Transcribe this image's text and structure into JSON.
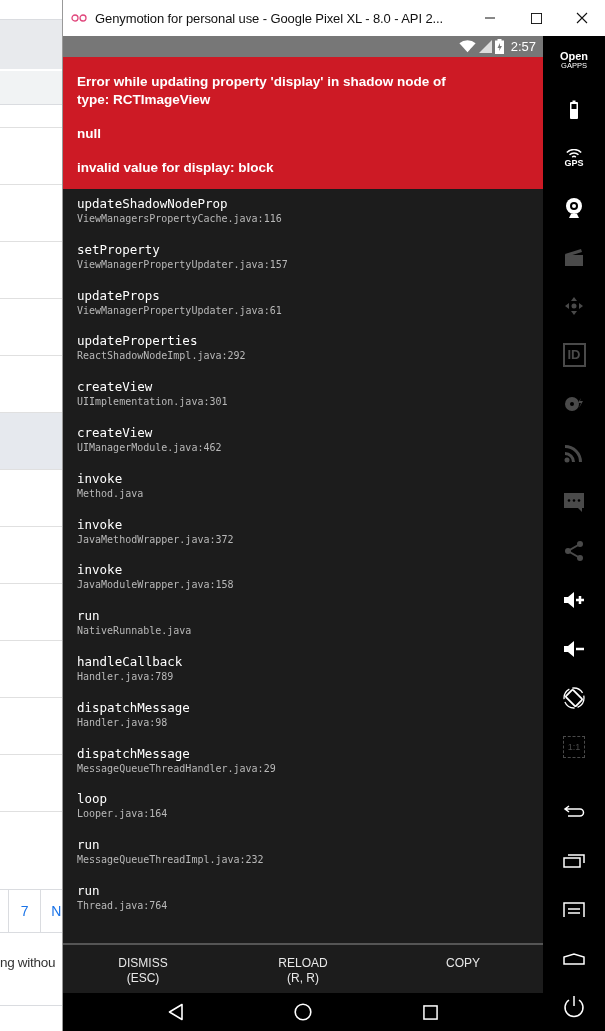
{
  "background_page": {
    "rows": [
      {
        "highlighted": false
      },
      {
        "highlighted": false
      },
      {
        "highlighted": false
      },
      {
        "highlighted": false
      },
      {
        "highlighted": false
      },
      {
        "highlighted": true
      },
      {
        "highlighted": false
      },
      {
        "highlighted": false
      },
      {
        "highlighted": false
      },
      {
        "highlighted": false
      },
      {
        "highlighted": false
      },
      {
        "highlighted": false
      },
      {
        "highlighted": false
      }
    ],
    "pagination": [
      {
        "label": "7"
      },
      {
        "label": "N"
      }
    ],
    "text": "ng withou"
  },
  "window": {
    "title": "Genymotion for personal use - Google Pixel XL - 8.0 - API 2..."
  },
  "status_bar": {
    "time": "2:57"
  },
  "error": {
    "lines": [
      "Error while updating property 'display' in shadow node of type: RCTImageView",
      "null",
      "invalid value for display: block"
    ]
  },
  "stack": [
    {
      "method": "updateShadowNodeProp",
      "location": "ViewManagersPropertyCache.java:116"
    },
    {
      "method": "setProperty",
      "location": "ViewManagerPropertyUpdater.java:157"
    },
    {
      "method": "updateProps",
      "location": "ViewManagerPropertyUpdater.java:61"
    },
    {
      "method": "updateProperties",
      "location": "ReactShadowNodeImpl.java:292"
    },
    {
      "method": "createView",
      "location": "UIImplementation.java:301"
    },
    {
      "method": "createView",
      "location": "UIManagerModule.java:462"
    },
    {
      "method": "invoke",
      "location": "Method.java"
    },
    {
      "method": "invoke",
      "location": "JavaMethodWrapper.java:372"
    },
    {
      "method": "invoke",
      "location": "JavaModuleWrapper.java:158"
    },
    {
      "method": "run",
      "location": "NativeRunnable.java"
    },
    {
      "method": "handleCallback",
      "location": "Handler.java:789"
    },
    {
      "method": "dispatchMessage",
      "location": "Handler.java:98"
    },
    {
      "method": "dispatchMessage",
      "location": "MessageQueueThreadHandler.java:29"
    },
    {
      "method": "loop",
      "location": "Looper.java:164"
    },
    {
      "method": "run",
      "location": "MessageQueueThreadImpl.java:232"
    },
    {
      "method": "run",
      "location": "Thread.java:764"
    }
  ],
  "actions": [
    {
      "label": "DISMISS",
      "shortcut": "(ESC)"
    },
    {
      "label": "RELOAD",
      "shortcut": "(R, R)"
    },
    {
      "label": "COPY"
    }
  ],
  "sidebar": {
    "top": [
      {
        "kind": "gapps",
        "enabled": true,
        "label": "Open",
        "sublabel": "GAPPS"
      },
      {
        "kind": "battery",
        "enabled": true
      },
      {
        "kind": "gps",
        "enabled": true,
        "label": "GPS"
      },
      {
        "kind": "webcam",
        "enabled": true
      },
      {
        "kind": "clapper",
        "enabled": false
      },
      {
        "kind": "dpad",
        "enabled": false
      },
      {
        "kind": "id",
        "enabled": false,
        "label": "ID"
      },
      {
        "kind": "disk",
        "enabled": false
      },
      {
        "kind": "rss",
        "enabled": false
      },
      {
        "kind": "sms",
        "enabled": false
      },
      {
        "kind": "share",
        "enabled": false
      },
      {
        "kind": "volup",
        "enabled": true
      },
      {
        "kind": "voldown",
        "enabled": true
      },
      {
        "kind": "rotate",
        "enabled": true
      },
      {
        "kind": "scale",
        "enabled": false,
        "label": "1:1"
      }
    ],
    "bottom": [
      {
        "kind": "back",
        "enabled": true
      },
      {
        "kind": "recents",
        "enabled": true
      },
      {
        "kind": "menu",
        "enabled": true
      },
      {
        "kind": "home",
        "enabled": true
      },
      {
        "kind": "power",
        "enabled": true
      }
    ]
  }
}
